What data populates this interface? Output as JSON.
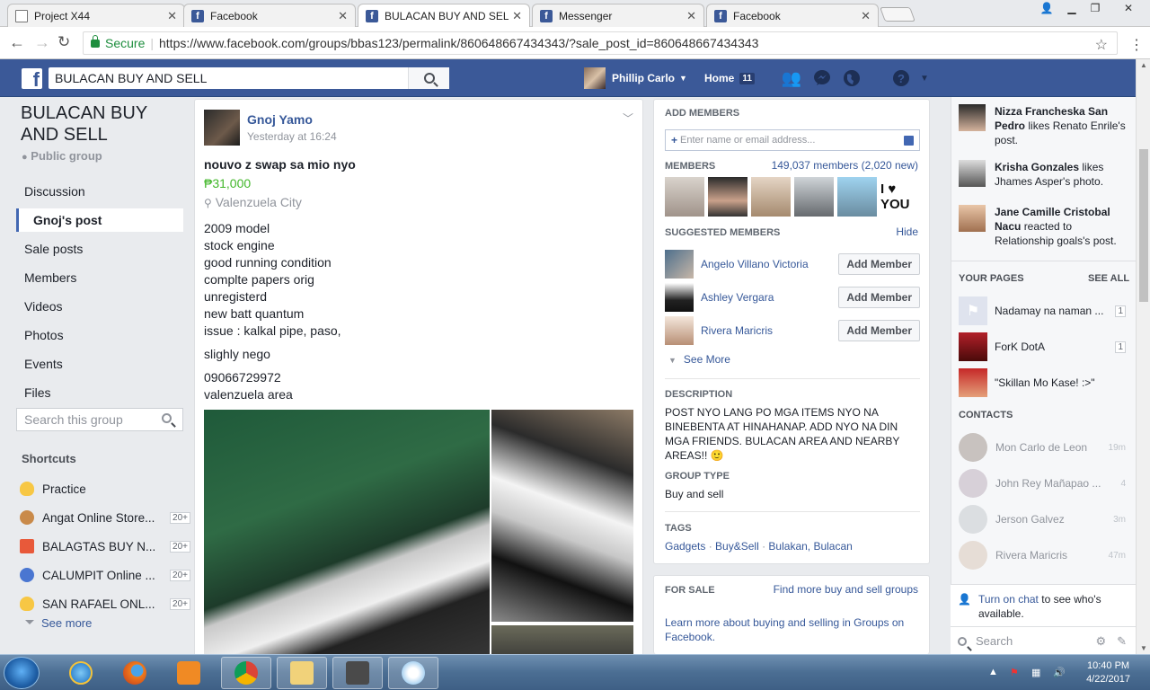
{
  "browser": {
    "tabs": [
      {
        "title": "Project X44",
        "icon": "document-icon"
      },
      {
        "title": "Facebook",
        "icon": "facebook-icon"
      },
      {
        "title": "BULACAN BUY AND SELL",
        "icon": "facebook-icon"
      },
      {
        "title": "Messenger",
        "icon": "facebook-icon"
      },
      {
        "title": "Facebook",
        "icon": "facebook-icon"
      }
    ],
    "secure_label": "Secure",
    "url": "https://www.facebook.com/groups/bbas123/permalink/860648667434343/?sale_post_id=860648667434343"
  },
  "fb_header": {
    "search_value": "BULACAN BUY AND SELL",
    "user_name": "Phillip Carlo",
    "home_label": "Home",
    "home_count": "11"
  },
  "left": {
    "group_title": "BULACAN BUY AND SELL",
    "group_type": "Public group",
    "nav": [
      "Discussion",
      "Gnoj's post",
      "Sale posts",
      "Members",
      "Videos",
      "Photos",
      "Events",
      "Files"
    ],
    "search_placeholder": "Search this group",
    "shortcuts_heading": "Shortcuts",
    "shortcuts": [
      {
        "label": "Practice",
        "badge": ""
      },
      {
        "label": "Angat Online Store...",
        "badge": "20+"
      },
      {
        "label": "BALAGTAS BUY N...",
        "badge": "20+"
      },
      {
        "label": "CALUMPIT Online ...",
        "badge": "20+"
      },
      {
        "label": "SAN RAFAEL ONL...",
        "badge": "20+"
      }
    ],
    "see_more": "See more"
  },
  "post": {
    "author": "Gnoj Yamo",
    "time": "Yesterday at 16:24",
    "title": "nouvo z swap sa mio nyo",
    "price": "₱31,000",
    "location": "Valenzuela City",
    "lines": [
      "2009 model",
      "stock engine",
      "good running condition",
      "complte papers orig",
      "unregisterd",
      "new batt quantum",
      "issue : kalkal pipe, paso,"
    ],
    "line_nego": "slighly nego",
    "phone": "09066729972",
    "area": "valenzuela area"
  },
  "members_card": {
    "add_heading": "ADD MEMBERS",
    "add_placeholder": "Enter name or email address...",
    "members_heading": "MEMBERS",
    "members_count": "149,037 members (2,020 new)",
    "suggested_heading": "SUGGESTED MEMBERS",
    "hide": "Hide",
    "suggested": [
      "Angelo Villano Victoria",
      "Ashley Vergara",
      "Rivera Maricris"
    ],
    "add_button": "Add Member",
    "see_more": "See More",
    "desc_heading": "DESCRIPTION",
    "description": "POST NYO LANG PO MGA ITEMS NYO NA BINEBENTA AT HINAHANAP. ADD NYO NA DIN MGA FRIENDS. BULACAN AREA AND NEARBY AREAS!! 🙂",
    "type_heading": "GROUP TYPE",
    "type_value": "Buy and sell",
    "tags_heading": "TAGS",
    "tags": [
      "Gadgets",
      "Buy&Sell",
      "Bulakan, Bulacan"
    ],
    "i_love_you": "I ♥ YOU"
  },
  "sale_card": {
    "heading": "FOR SALE",
    "find_link": "Find more buy and sell groups",
    "learn": "Learn more about buying and selling in Groups on Facebook."
  },
  "sidebar": {
    "ticker": [
      {
        "name": "Nizza Francheska San Pedro",
        "action": "likes Renato Enrile's post."
      },
      {
        "name": "Krisha Gonzales",
        "action": "likes Jhames Asper's photo."
      },
      {
        "name": "Jane Camille Cristobal Nacu",
        "action": "reacted to Relationship goals's post."
      }
    ],
    "your_pages": "YOUR PAGES",
    "see_all": "SEE ALL",
    "pages": [
      {
        "name": "Nadamay na naman ...",
        "count": "1"
      },
      {
        "name": "ForK DotA",
        "count": "1"
      },
      {
        "name": "\"Skillan Mo Kase! :>\"",
        "count": ""
      }
    ],
    "contacts_heading": "CONTACTS",
    "contacts": [
      {
        "name": "Mon Carlo de Leon",
        "time": "19m"
      },
      {
        "name": "John Rey Mañapao ...",
        "time": "4"
      },
      {
        "name": "Jerson Galvez",
        "time": "3m"
      },
      {
        "name": "Rivera Maricris",
        "time": "47m"
      }
    ],
    "chat_link": "Turn on chat",
    "chat_rest": "to see who's available.",
    "search_placeholder": "Search"
  },
  "taskbar": {
    "time": "10:40 PM",
    "date": "4/22/2017"
  }
}
